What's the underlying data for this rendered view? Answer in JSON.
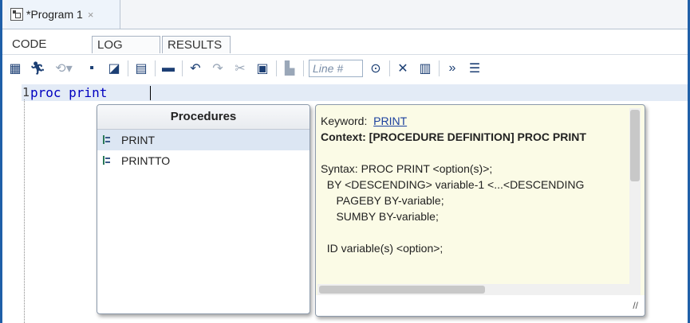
{
  "doc_tab": {
    "title": "*Program 1",
    "close": "×"
  },
  "subtabs": {
    "code": "CODE",
    "log": "LOG",
    "results": "RESULTS"
  },
  "toolbar": {
    "line_placeholder": "Line #",
    "icons": [
      "run-icon",
      "run-selected-icon",
      "history-icon",
      "save-icon",
      "save-as-icon",
      "export-icon",
      "print-icon",
      "undo-icon",
      "redo-icon",
      "cut-icon",
      "paste-icon",
      "copy-icon",
      "goto-line-icon",
      "clear-icon",
      "format-icon",
      "submit-icon",
      "more-icon"
    ]
  },
  "editor": {
    "line_number": "1",
    "code": "proc print"
  },
  "autocomplete": {
    "header": "Procedures",
    "items": [
      {
        "label": "PRINT",
        "selected": true
      },
      {
        "label": "PRINTTO",
        "selected": false
      }
    ]
  },
  "info": {
    "keyword_label": "Keyword:",
    "keyword": "PRINT",
    "context": "Context: [PROCEDURE DEFINITION] PROC PRINT",
    "syntax": "Syntax: PROC PRINT <option(s)>;",
    "by": "  BY <DESCENDING> variable-1 <...<DESCENDING",
    "pageby": "     PAGEBY BY-variable;",
    "sumby": "     SUMBY BY-variable;",
    "id": "  ID variable(s) <option>;",
    "grip": "//"
  }
}
